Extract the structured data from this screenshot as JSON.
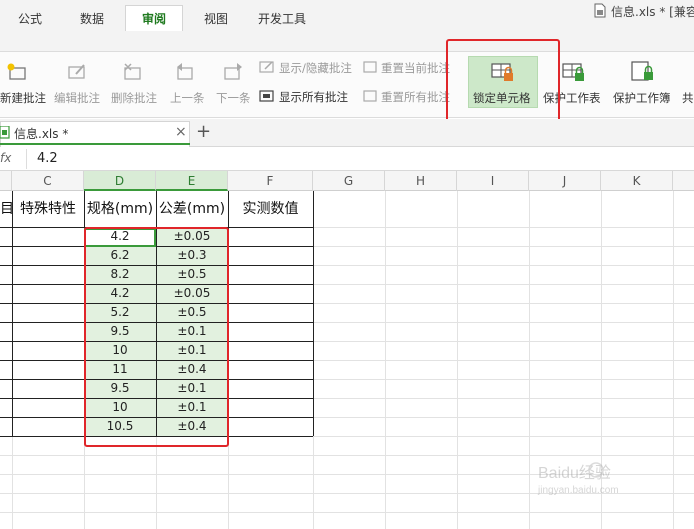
{
  "window": {
    "title": "信息.xls * [兼容"
  },
  "tabs": [
    {
      "label": "公式"
    },
    {
      "label": "数据"
    },
    {
      "label": "审阅"
    },
    {
      "label": "视图"
    },
    {
      "label": "开发工具"
    }
  ],
  "ribbon": {
    "new_comment": "新建批注",
    "edit_comment": "编辑批注",
    "delete_comment": "删除批注",
    "prev": "上一条",
    "next": "下一条",
    "show_hide_comment": "显示/隐藏批注",
    "reset_current_comment": "重置当前批注",
    "show_all_comments": "显示所有批注",
    "reset_all_comments": "重置所有批注",
    "lock_cell": "锁定单元格",
    "protect_sheet": "保护工作表",
    "protect_workbook": "保护工作簿",
    "share": "共"
  },
  "doc_tab": {
    "name": "信息.xls *",
    "close": "×",
    "add": "+"
  },
  "formula_bar": {
    "fx": "fx",
    "value": "4.2"
  },
  "columns": [
    "C",
    "D",
    "E",
    "F",
    "G",
    "H",
    "I",
    "J",
    "K"
  ],
  "table": {
    "headers": {
      "b_partial": "目",
      "c": "特殊特性",
      "d": "规格(mm)",
      "e": "公差(mm)",
      "f": "实测数值"
    },
    "rows": [
      {
        "spec": "4.2",
        "tol": "±0.05"
      },
      {
        "spec": "6.2",
        "tol": "±0.3"
      },
      {
        "spec": "8.2",
        "tol": "±0.5"
      },
      {
        "spec": "4.2",
        "tol": "±0.05"
      },
      {
        "spec": "5.2",
        "tol": "±0.5"
      },
      {
        "spec": "9.5",
        "tol": "±0.1"
      },
      {
        "spec": "10",
        "tol": "±0.1"
      },
      {
        "spec": "11",
        "tol": "±0.4"
      },
      {
        "spec": "9.5",
        "tol": "±0.1"
      },
      {
        "spec": "10",
        "tol": "±0.1"
      },
      {
        "spec": "10.5",
        "tol": "±0.4"
      }
    ]
  },
  "watermark": {
    "text": "Baidu经验",
    "sub": "jingyan.baidu.com"
  },
  "colors": {
    "accent": "#3a9a3a",
    "highlight": "#e0262a",
    "selected_fill": "#e2f1df"
  }
}
